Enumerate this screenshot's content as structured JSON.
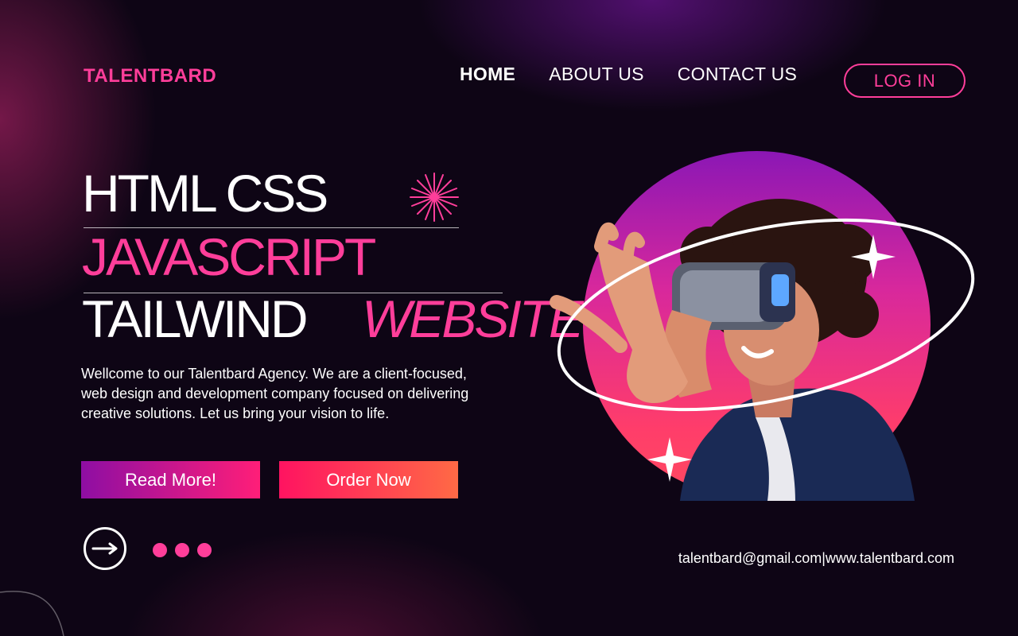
{
  "brand": "TALENTBARD",
  "nav": {
    "home": "HOME",
    "about": "ABOUT US",
    "contact": "CONTACT US",
    "login": "LOG IN"
  },
  "hero": {
    "line1": "HTML CSS",
    "line2": "JAVASCRIPT",
    "line3": "TAILWIND",
    "line4": "WEBSITE",
    "description": "Wellcome to our Talentbard Agency. We are a client-focused, web design and development company focused on delivering creative solutions. Let us bring your vision to life."
  },
  "buttons": {
    "read_more": "Read More!",
    "order_now": "Order Now"
  },
  "footer": {
    "contact": "talentbard@gmail.com|www.talentbard.com"
  },
  "icons": {
    "arrow": "arrow-right-icon",
    "sparkle": "sparkle-icon",
    "star": "star-burst-icon"
  },
  "colors": {
    "accent": "#ff3e9a",
    "background": "#0e0515",
    "read_more_gradient": [
      "#8e0ea3",
      "#ff1e78"
    ],
    "order_now_gradient": [
      "#ff1361",
      "#ff6a45"
    ]
  }
}
